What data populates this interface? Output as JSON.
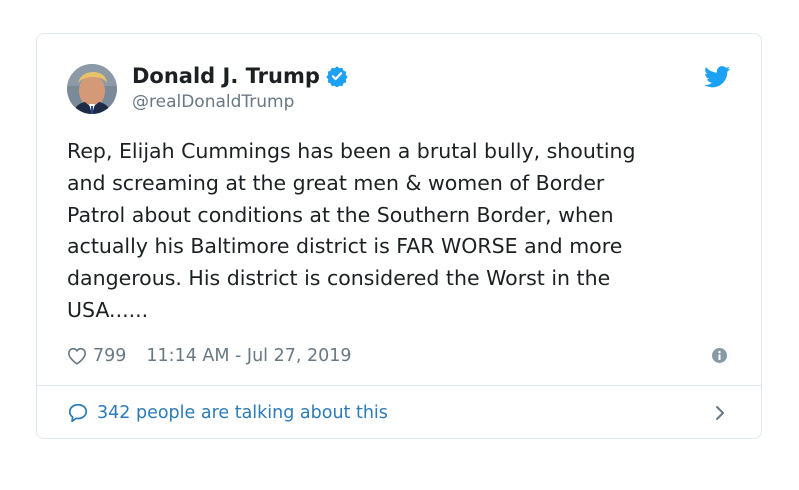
{
  "tweet": {
    "author": {
      "display_name": "Donald J. Trump",
      "handle": "@realDonaldTrump",
      "verified": true
    },
    "text": "Rep, Elijah Cummings has been a brutal bully, shouting\nand screaming at the great men & women of Border\nPatrol about conditions at the Southern Border, when\nactually his Baltimore district is FAR WORSE and more\ndangerous. His district is considered the Worst in the\nUSA......",
    "likes": "799",
    "timestamp": "11:14 AM - Jul 27, 2019",
    "conversation": "342 people are talking about this"
  },
  "icons": {
    "brand": "twitter-bird-icon",
    "verified": "verified-badge-icon",
    "like": "heart-icon",
    "info": "info-icon",
    "conversation": "speech-bubble-icon",
    "chevron": "chevron-right-icon"
  },
  "colors": {
    "brand_blue": "#1da1f2",
    "link_blue": "#2b7bb9",
    "text": "#1c2022",
    "muted": "#697882",
    "border": "#e1e8ed"
  }
}
